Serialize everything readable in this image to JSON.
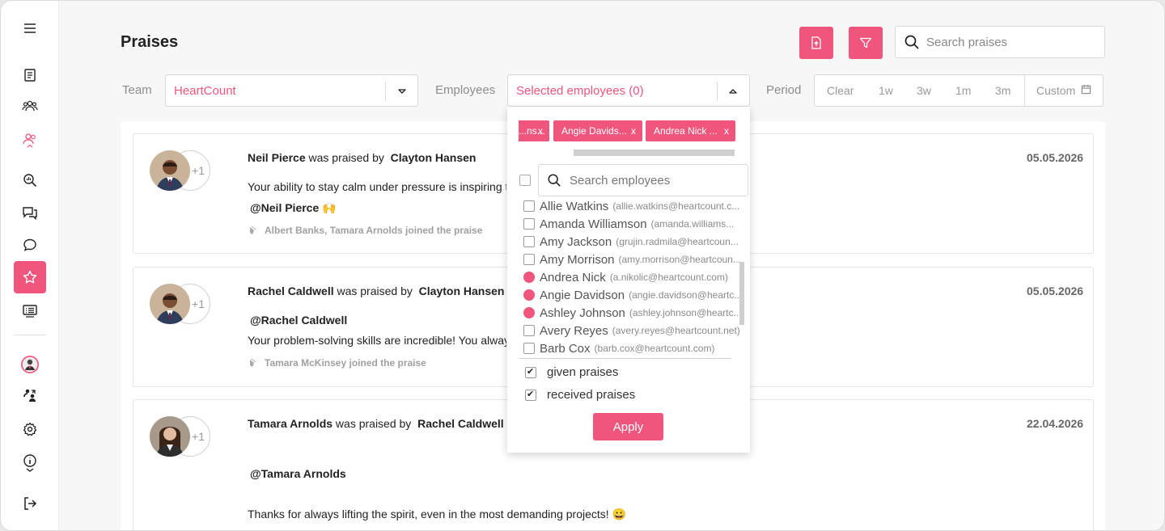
{
  "page": {
    "title": "Praises"
  },
  "header": {
    "export_icon": "file-upload-icon",
    "filter_icon": "funnel-icon",
    "search": {
      "placeholder": "Search praises",
      "value": ""
    }
  },
  "filters": {
    "team_label": "Team",
    "team_value": "HeartCount",
    "employees_label": "Employees",
    "employees_value": "Selected employees (0)",
    "period_label": "Period",
    "period_options": [
      "Clear",
      "1w",
      "3w",
      "1m",
      "3m",
      "Custom"
    ]
  },
  "sidebar": {
    "items": [
      {
        "icon": "menu-icon"
      },
      {
        "icon": "report-icon"
      },
      {
        "icon": "team-icon"
      },
      {
        "icon": "users-icon"
      },
      {
        "icon": "analytics-icon"
      },
      {
        "icon": "chats-icon"
      },
      {
        "icon": "chat-icon"
      },
      {
        "icon": "star-icon",
        "active": true
      },
      {
        "icon": "list-icon"
      },
      {
        "icon": "profile-avatar"
      },
      {
        "icon": "switch-users-icon"
      },
      {
        "icon": "settings-icon"
      },
      {
        "icon": "info-icon"
      },
      {
        "icon": "logout-icon"
      }
    ]
  },
  "praises": [
    {
      "receiver": "Neil Pierce",
      "praised_by_text": "was praised by",
      "giver": "Clayton Hansen",
      "message": "Your ability to stay calm under pressure is inspiring to the whole team.",
      "mention": "@Neil Pierce  🙌",
      "joined": "Albert Banks, Tamara Arnolds joined the praise",
      "date": "05.05.2026",
      "plus": "+1"
    },
    {
      "receiver": "Rachel Caldwell",
      "praised_by_text": "was praised by",
      "giver": "Clayton Hansen",
      "mention": "@Rachel Caldwell",
      "message": "Your problem-solving skills are incredible! You always find a way forward.",
      "joined": "Tamara McKinsey joined the praise",
      "date": "05.05.2026",
      "plus": "+1"
    },
    {
      "receiver": "Tamara Arnolds",
      "praised_by_text": "was praised by",
      "giver": "Rachel Caldwell",
      "mention": "@Tamara Arnolds",
      "message": "Thanks for always lifting the spirit, even in the most demanding projects! 😀",
      "date": "22.04.2026",
      "plus": "+1"
    }
  ],
  "dropdown": {
    "chips": [
      "...ns...",
      "Angie Davids...",
      "Andrea Nick ..."
    ],
    "chip_close": "x",
    "search_placeholder": "Search employees",
    "employees": [
      {
        "name": "Allie Watkins",
        "email": "(allie.watkins@heartcount.c...",
        "selected": false
      },
      {
        "name": "Amanda Williamson",
        "email": "(amanda.williams...",
        "selected": false
      },
      {
        "name": "Amy Jackson",
        "email": "(grujin.radmila@heartcoun...",
        "selected": false
      },
      {
        "name": "Amy Morrison",
        "email": "(amy.morrison@heartcoun...",
        "selected": false
      },
      {
        "name": "Andrea Nick",
        "email": "(a.nikolic@heartcount.com)",
        "selected": true
      },
      {
        "name": "Angie Davidson",
        "email": "(angie.davidson@heartc...",
        "selected": true
      },
      {
        "name": "Ashley Johnson",
        "email": "(ashley.johnson@heartc...",
        "selected": true
      },
      {
        "name": "Avery Reyes",
        "email": "(avery.reyes@heartcount.net)",
        "selected": false
      },
      {
        "name": "Barb Cox",
        "email": "(barb.cox@heartcount.com)",
        "selected": false
      }
    ],
    "options": [
      {
        "label": "given praises",
        "checked": true
      },
      {
        "label": "received praises",
        "checked": true
      }
    ],
    "apply_label": "Apply"
  },
  "colors": {
    "accent": "#f0567d",
    "text": "#222222",
    "muted": "#8c8c8c"
  }
}
